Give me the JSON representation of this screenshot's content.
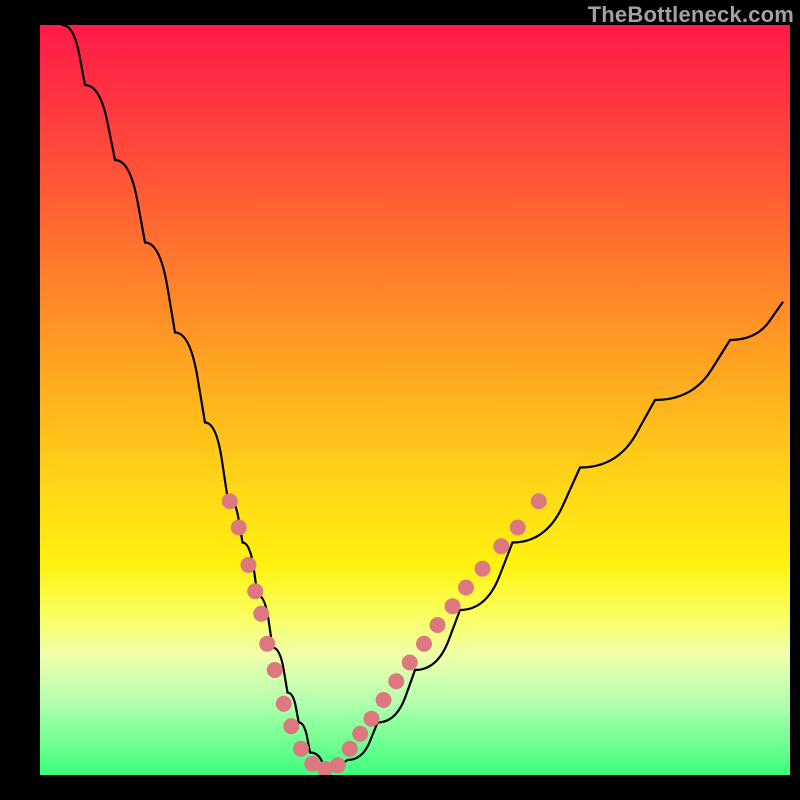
{
  "watermark": "TheBottleneck.com",
  "colors": {
    "frame": "#000000",
    "curve": "#000000",
    "dots": "#dd7880",
    "gradient_top": "#ff1a4a",
    "gradient_bottom": "#3bff7a"
  },
  "chart_data": {
    "type": "line",
    "title": "",
    "xlabel": "",
    "ylabel": "",
    "xlim": [
      0,
      100
    ],
    "ylim": [
      0,
      100
    ],
    "grid": false,
    "legend": false,
    "note": "Values for annotated dots are estimated from pixel positions; y is measured upward from the bottom of the gradient area (0 = bottom, 100 = top).",
    "series": [
      {
        "name": "bottleneck-curve",
        "x": [
          3,
          6,
          10,
          14,
          18,
          22,
          25,
          27,
          29,
          31,
          33,
          34.5,
          36,
          38,
          41,
          45,
          50,
          56,
          63,
          72,
          82,
          92,
          99
        ],
        "y": [
          100,
          92,
          82,
          71,
          59,
          47,
          37,
          31,
          24,
          17,
          11,
          7,
          3,
          1,
          2,
          7,
          14,
          22,
          31,
          41,
          50,
          58,
          63
        ]
      }
    ],
    "annotated_points": [
      {
        "x": 25.3,
        "y": 36.5
      },
      {
        "x": 26.5,
        "y": 33.0
      },
      {
        "x": 27.8,
        "y": 28.0
      },
      {
        "x": 28.7,
        "y": 24.5
      },
      {
        "x": 29.5,
        "y": 21.5
      },
      {
        "x": 30.3,
        "y": 17.5
      },
      {
        "x": 31.3,
        "y": 14.0
      },
      {
        "x": 32.5,
        "y": 9.5
      },
      {
        "x": 33.5,
        "y": 6.5
      },
      {
        "x": 34.8,
        "y": 3.5
      },
      {
        "x": 36.3,
        "y": 1.5
      },
      {
        "x": 38.0,
        "y": 0.8
      },
      {
        "x": 39.7,
        "y": 1.3
      },
      {
        "x": 41.3,
        "y": 3.5
      },
      {
        "x": 42.7,
        "y": 5.5
      },
      {
        "x": 44.2,
        "y": 7.5
      },
      {
        "x": 45.8,
        "y": 10.0
      },
      {
        "x": 47.5,
        "y": 12.5
      },
      {
        "x": 49.3,
        "y": 15.0
      },
      {
        "x": 51.2,
        "y": 17.5
      },
      {
        "x": 53.0,
        "y": 20.0
      },
      {
        "x": 55.0,
        "y": 22.5
      },
      {
        "x": 56.8,
        "y": 25.0
      },
      {
        "x": 59.0,
        "y": 27.5
      },
      {
        "x": 61.5,
        "y": 30.5
      },
      {
        "x": 63.7,
        "y": 33.0
      },
      {
        "x": 66.5,
        "y": 36.5
      }
    ]
  }
}
